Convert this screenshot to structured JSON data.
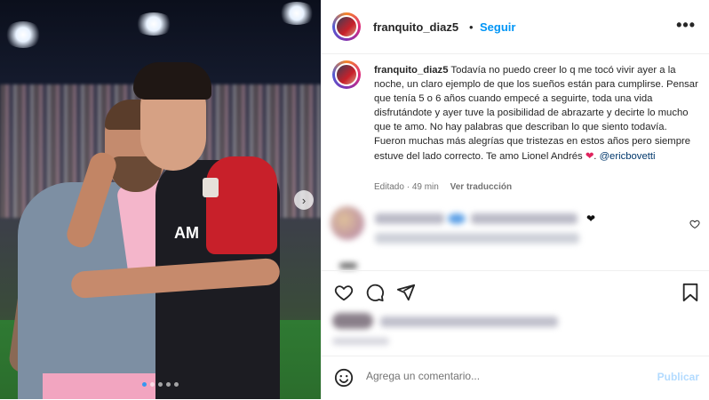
{
  "post": {
    "username": "franquito_diaz5",
    "separator": "•",
    "follow_label": "Seguir",
    "more_label": "•••",
    "caption_text": "Todavía no puedo creer lo q me tocó vivir ayer a la noche, un claro ejemplo de que los sueños están para cumplirse. Pensar que tenía 5 o 6 años cuando empecé a seguirte, toda una vida disfrutándote y ayer tuve la posibilidad de abrazarte y decirte lo mucho que te amo. No hay palabras que describan lo que siento todavía. Fueron muchas más alegrías que tristezas en estos años pero siempre estuve del lado correcto. Te amo Lionel Andrés",
    "caption_heart": "❤",
    "caption_after_heart": ". ",
    "mention": "@ericbovetti",
    "edited_label": "Editado",
    "time_ago": "49 min",
    "meta_separator": "·",
    "translate_label": "Ver traducción"
  },
  "photo": {
    "sponsor_text": "AM",
    "carousel_next": "›",
    "slide_count": 5,
    "active_slide": 1
  },
  "actions": {
    "like_icon": "heart-outline-icon",
    "comment_icon": "comment-icon",
    "share_icon": "send-icon",
    "save_icon": "bookmark-icon"
  },
  "comment_box": {
    "emoji_icon": "smile-icon",
    "placeholder": "Agrega un comentario...",
    "post_label": "Publicar"
  },
  "colors": {
    "link_blue": "#0095f6",
    "publish_disabled": "#b3dbff",
    "heart_red": "#e0245e"
  }
}
